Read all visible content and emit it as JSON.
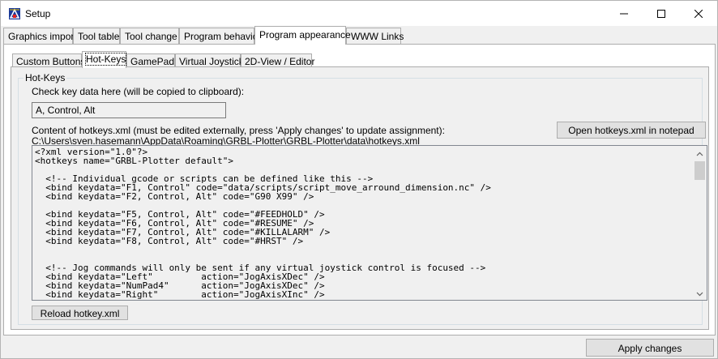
{
  "window": {
    "title": "Setup",
    "minimize_icon": "minimize-icon",
    "maximize_icon": "maximize-icon",
    "close_icon": "close-icon"
  },
  "tabs": [
    {
      "label": "Graphics import",
      "active": false
    },
    {
      "label": "Tool table",
      "active": false
    },
    {
      "label": "Tool change",
      "active": false
    },
    {
      "label": "Program behavior",
      "active": false
    },
    {
      "label": "Program appearance",
      "active": true
    },
    {
      "label": "WWW Links",
      "active": false
    }
  ],
  "subtabs": [
    {
      "label": "Custom Buttons",
      "active": false
    },
    {
      "label": "Hot-Keys",
      "active": true
    },
    {
      "label": "GamePad",
      "active": false
    },
    {
      "label": "Virtual Joystick",
      "active": false
    },
    {
      "label": "2D-View / Editor",
      "active": false
    }
  ],
  "hotkeys": {
    "group_title": "Hot-Keys",
    "check_label": "Check key data here (will be copied to clipboard):",
    "key_value": "A, Control, Alt",
    "content_label": "Content of hotkeys.xml (must be edited externally, press 'Apply changes' to update assignment):",
    "path": "C:\\Users\\sven.hasemann\\AppData\\Roaming\\GRBL-Plotter\\GRBL-Plotter\\data\\hotkeys.xml",
    "open_button": "Open hotkeys.xml in notepad",
    "reload_button": "Reload hotkey.xml",
    "xml_lines": [
      "<?xml version=\"1.0\"?>",
      "<hotkeys name=\"GRBL-Plotter default\">",
      "",
      "  <!-- Individual gcode or scripts can be defined like this -->",
      "  <bind keydata=\"F1, Control\" code=\"data/scripts/script_move_arround_dimension.nc\" />",
      "  <bind keydata=\"F2, Control, Alt\" code=\"G90 X99\" />",
      "",
      "  <bind keydata=\"F5, Control, Alt\" code=\"#FEEDHOLD\" />",
      "  <bind keydata=\"F6, Control, Alt\" code=\"#RESUME\" />",
      "  <bind keydata=\"F7, Control, Alt\" code=\"#KILLALARM\" />",
      "  <bind keydata=\"F8, Control, Alt\" code=\"#HRST\" />",
      "",
      "",
      "  <!-- Jog commands will only be sent if any virtual joystick control is focused -->",
      "  <bind keydata=\"Left\"         action=\"JogAxisXDec\" />",
      "  <bind keydata=\"NumPad4\"      action=\"JogAxisXDec\" />",
      "  <bind keydata=\"Right\"        action=\"JogAxisXInc\" />"
    ]
  },
  "footer": {
    "apply_button": "Apply changes"
  }
}
